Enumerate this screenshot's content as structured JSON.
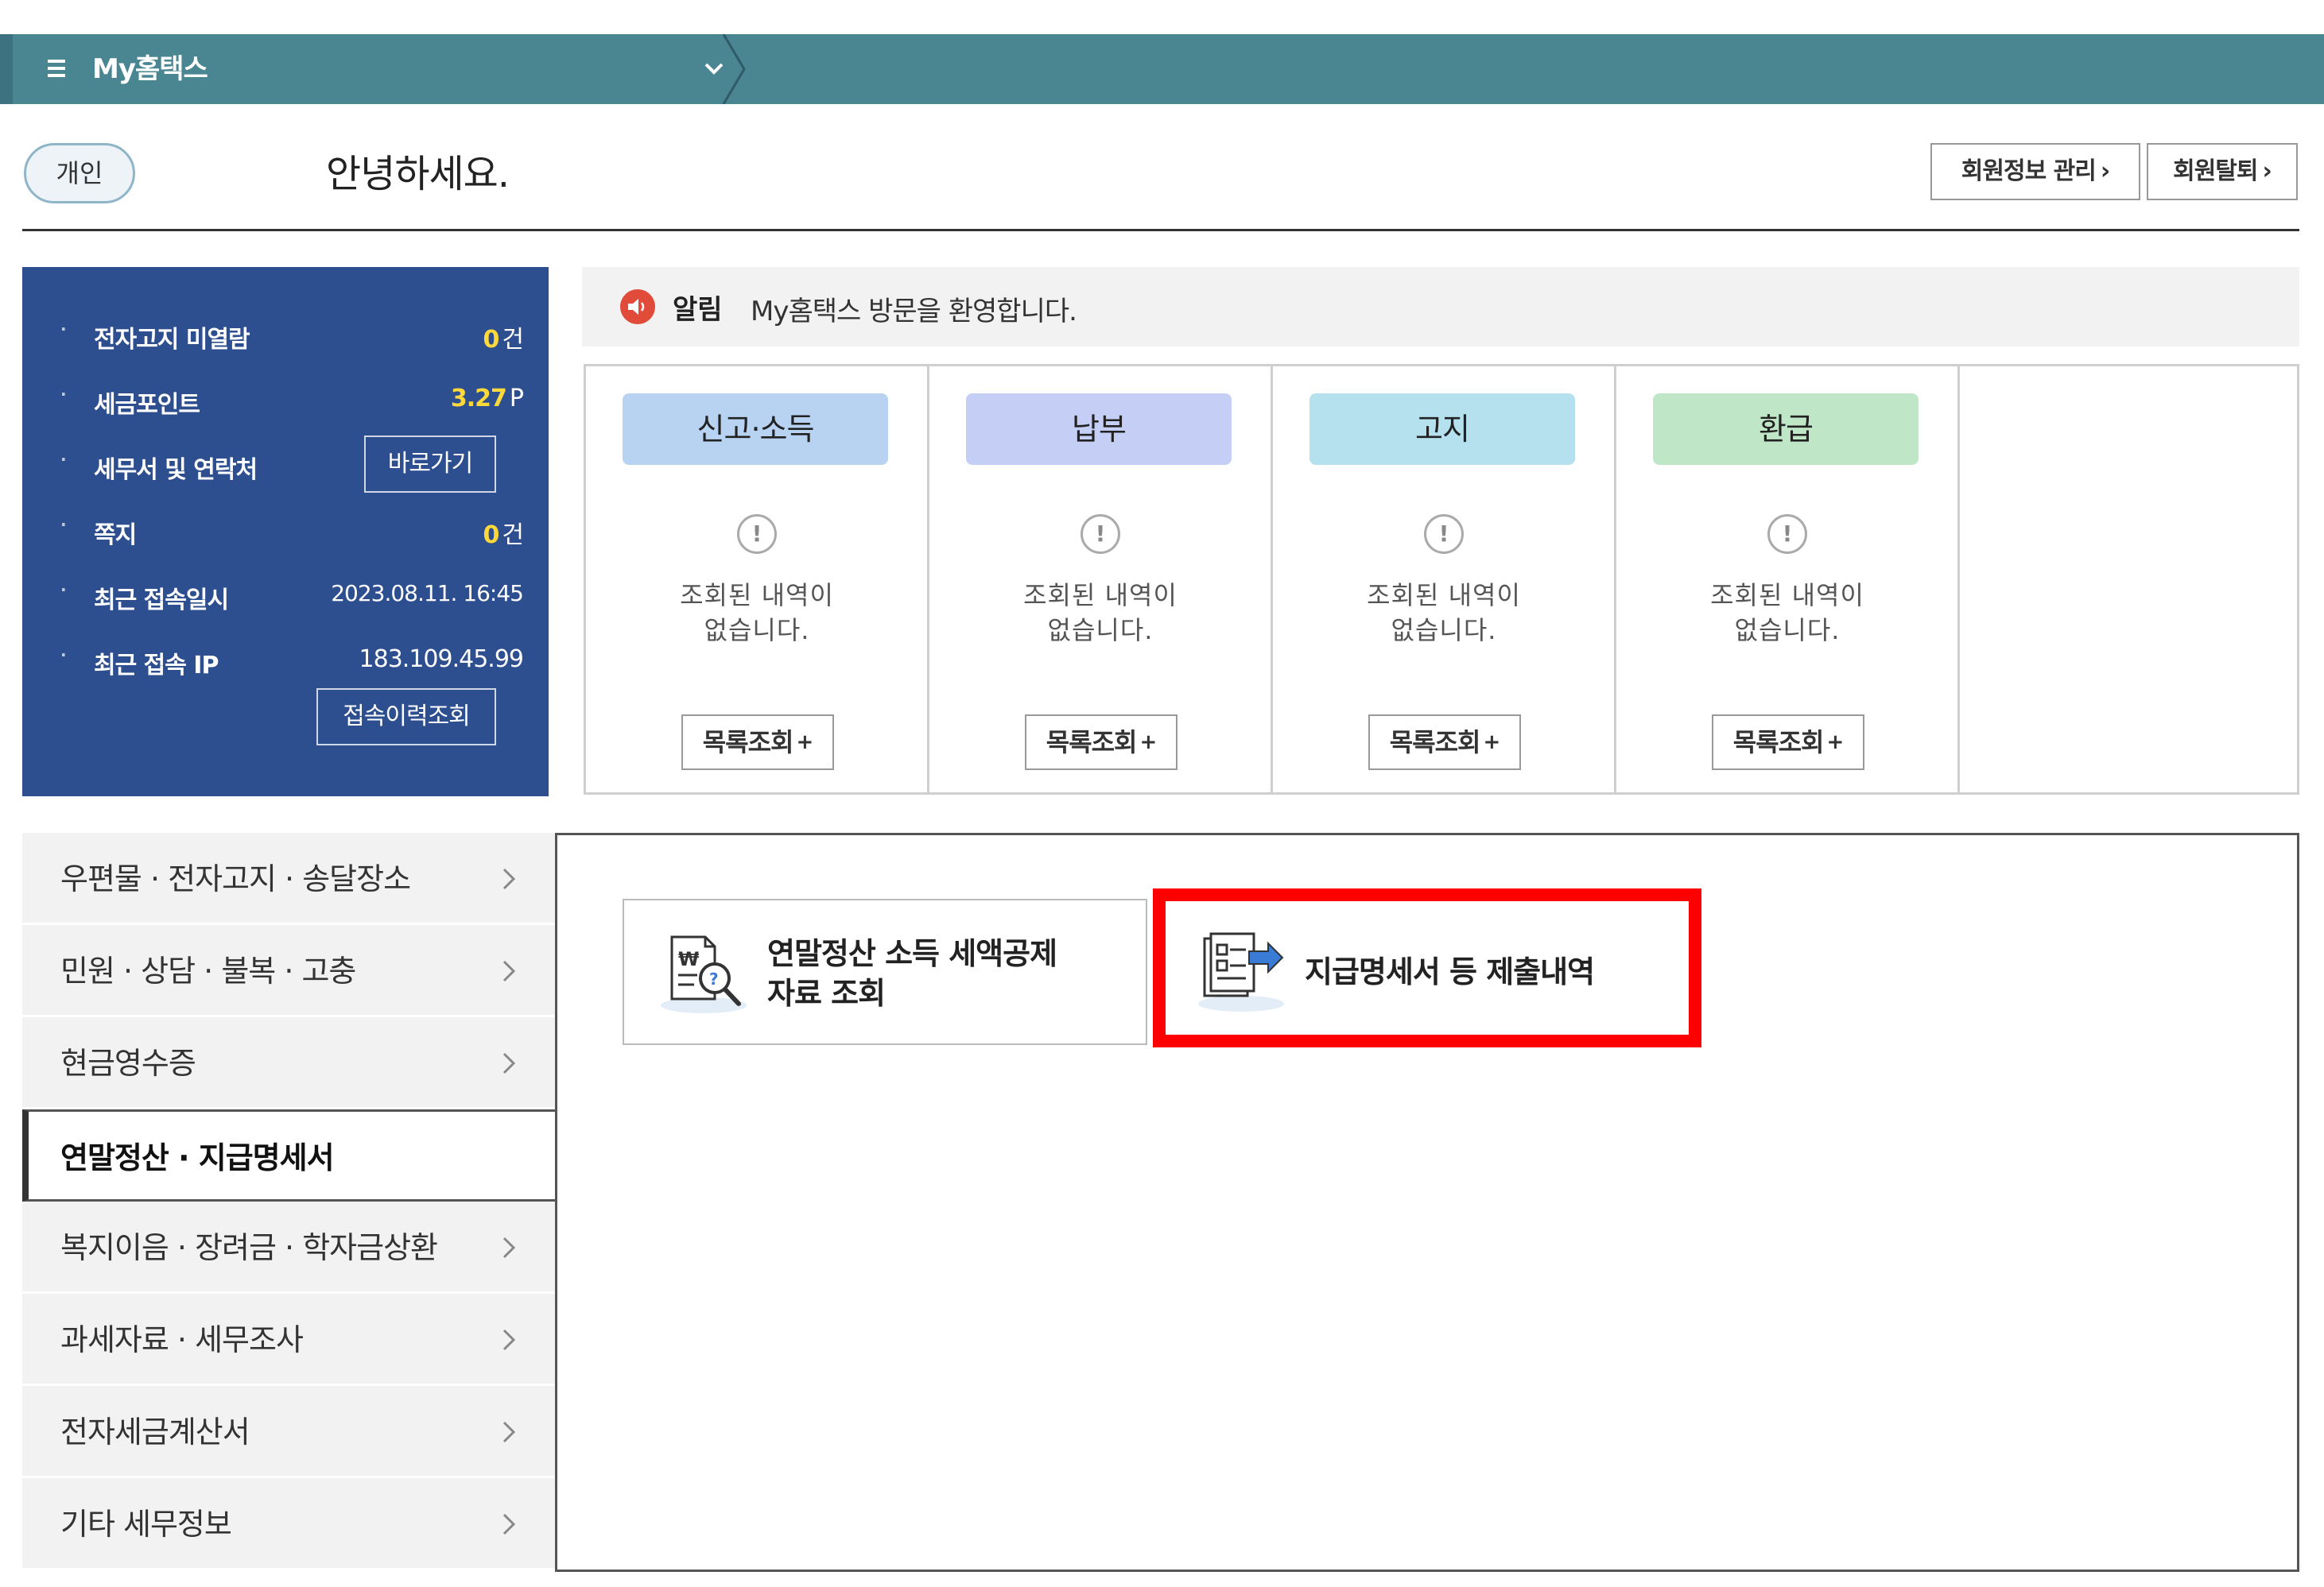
{
  "topbar": {
    "title": "My홈택스"
  },
  "greeting": {
    "badge": "개인",
    "message": "안녕하세요.",
    "member_info_button": "회원정보 관리",
    "withdraw_button": "회원탈퇴"
  },
  "info_panel": {
    "rows": [
      {
        "label": "전자고지 미열람",
        "value": "0",
        "unit": "건"
      },
      {
        "label": "세금포인트",
        "value": "3.27",
        "unit": "P"
      },
      {
        "label": "세무서 및 연락처"
      },
      {
        "label": "쪽지",
        "value": "0",
        "unit": "건"
      },
      {
        "label": "최근 접속일시",
        "value": "2023.08.11.  16:45"
      },
      {
        "label": "최근 접속 IP",
        "value": "183.109.45.99"
      }
    ],
    "shortcut_button": "바로가기",
    "access_history_button": "접속이력조회"
  },
  "notice": {
    "label": "알림",
    "text": "My홈택스 방문을 환영합니다."
  },
  "cards": [
    {
      "title": "신고·소득",
      "color": "#b8d3f2",
      "message_line1": "조회된 내역이",
      "message_line2": "없습니다.",
      "button": "목록조회"
    },
    {
      "title": "납부",
      "color": "#c5cef5",
      "message_line1": "조회된 내역이",
      "message_line2": "없습니다.",
      "button": "목록조회"
    },
    {
      "title": "고지",
      "color": "#b5e0ee",
      "message_line1": "조회된 내역이",
      "message_line2": "없습니다.",
      "button": "목록조회"
    },
    {
      "title": "환급",
      "color": "#c0e6c8",
      "message_line1": "조회된 내역이",
      "message_line2": "없습니다.",
      "button": "목록조회"
    }
  ],
  "categories": [
    {
      "label": "우편물 · 전자고지 · 송달장소"
    },
    {
      "label": "민원 · 상담 · 불복 · 고충"
    },
    {
      "label": "현금영수증"
    },
    {
      "label": "연말정산 · 지급명세서",
      "active": true
    },
    {
      "label": "복지이음 · 장려금 · 학자금상환"
    },
    {
      "label": "과세자료 · 세무조사"
    },
    {
      "label": "전자세금계산서"
    },
    {
      "label": "기타 세무정보"
    }
  ],
  "tiles": [
    {
      "line1": "연말정산 소득 세액공제",
      "line2": "자료 조회",
      "icon": "document-search-icon"
    },
    {
      "line1": "지급명세서 등 제출내역",
      "icon": "document-submit-icon"
    }
  ],
  "colors": {
    "topbar": "#4a8592",
    "info_panel": "#2e4f8f",
    "highlight": "#ff0000",
    "point_yellow": "#ffd93b"
  }
}
